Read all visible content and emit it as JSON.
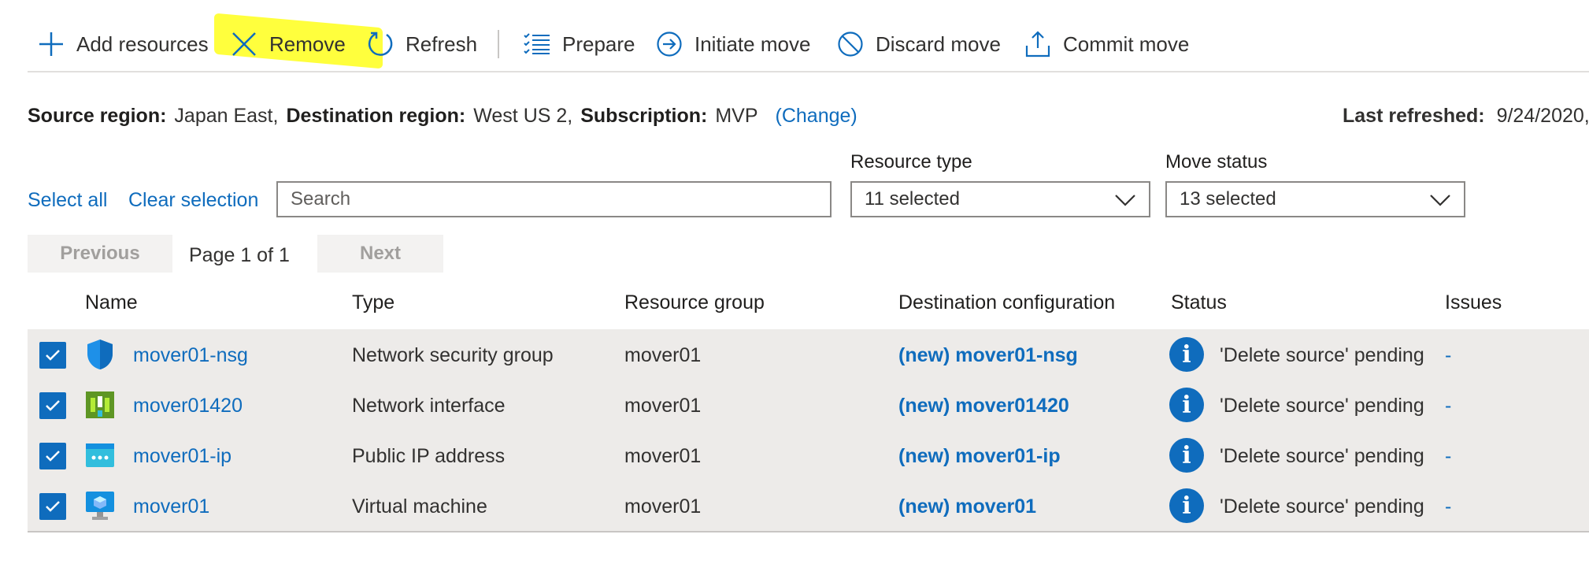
{
  "toolbar": {
    "add_resources": "Add resources",
    "remove": "Remove",
    "refresh": "Refresh",
    "prepare": "Prepare",
    "initiate_move": "Initiate move",
    "discard_move": "Discard move",
    "commit_move": "Commit move"
  },
  "info": {
    "source_label": "Source region:",
    "source_value": "Japan East,",
    "dest_label": "Destination region:",
    "dest_value": "West US 2,",
    "sub_label": "Subscription:",
    "sub_value": "MVP",
    "change_link": "(Change)",
    "last_refreshed_label": "Last refreshed:",
    "last_refreshed_value": "9/24/2020,"
  },
  "filters": {
    "select_all": "Select all",
    "clear_selection": "Clear selection",
    "search_placeholder": "Search",
    "resource_type_label": "Resource type",
    "resource_type_value": "11 selected",
    "move_status_label": "Move status",
    "move_status_value": "13 selected"
  },
  "paging": {
    "previous": "Previous",
    "page_text": "Page 1 of 1",
    "next": "Next"
  },
  "table": {
    "headers": {
      "name": "Name",
      "type": "Type",
      "resource_group": "Resource group",
      "destination": "Destination configuration",
      "status": "Status",
      "issues": "Issues"
    },
    "rows": [
      {
        "name": "mover01-nsg",
        "type": "Network security group",
        "rg": "mover01",
        "dest": "(new) mover01-nsg",
        "status": "'Delete source' pending",
        "issues": "-",
        "icon": "shield-icon"
      },
      {
        "name": "mover01420",
        "type": "Network interface",
        "rg": "mover01",
        "dest": "(new) mover01420",
        "status": "'Delete source' pending",
        "issues": "-",
        "icon": "network-interface-icon"
      },
      {
        "name": "mover01-ip",
        "type": "Public IP address",
        "rg": "mover01",
        "dest": "(new) mover01-ip",
        "status": "'Delete source' pending",
        "issues": "-",
        "icon": "public-ip-icon"
      },
      {
        "name": "mover01",
        "type": "Virtual machine",
        "rg": "mover01",
        "dest": "(new) mover01",
        "status": "'Delete source' pending",
        "issues": "-",
        "icon": "virtual-machine-icon"
      }
    ]
  },
  "colors": {
    "accent": "#0f6cbd",
    "highlight": "#ffff33",
    "row_bg": "#edebe9"
  }
}
